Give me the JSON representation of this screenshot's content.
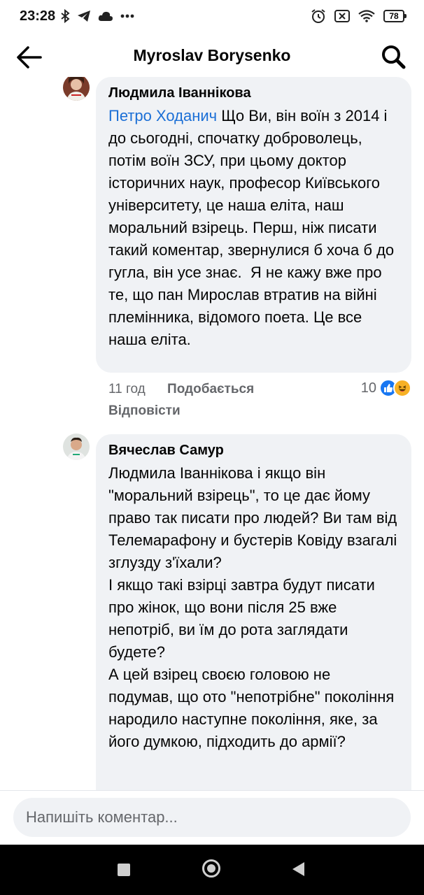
{
  "status_bar": {
    "time": "23:28",
    "battery": "78"
  },
  "header": {
    "title": "Myroslav Borysenko"
  },
  "comments": [
    {
      "author": "Людмила Іваннікова",
      "mention": "Петро Ходанич",
      "text": " Що Ви, він воїн з 2014 і до сьогодні, спочатку доброволець, потім воїн ЗСУ, при цьому доктор історичних наук, професор Київського університету, це наша еліта, наш моральний взірець. Перш, ніж писати такий коментар, звернулися б хоча б до гугла, він усе знає.  Я не кажу вже про те, що пан Мирослав втратив на війні племінника, відомого поета. Це все наша еліта.",
      "time": "11 год",
      "like_label": "Подобається",
      "reply_label": "Відповісти",
      "reaction_count": "10",
      "reactions": [
        "like-icon",
        "haha-icon"
      ]
    },
    {
      "author": "Вячеслав Самур",
      "text": "Людмила Іваннікова і якщо він \"моральний взірець\", то це дає йому право так писати про людей? Ви там від Телемарафону и бустерів Ковіду взагалі зглузду з'їхали?\nІ якщо такі взірці завтра будут писати про жінок, що вони після 25 вже непотріб, ви їм до рота заглядати будете?\nА цей взірец своєю головою не подумав, що ото \"непотрібне\" покоління народило наступне покоління, яке, за його думкою, підходить до армії?"
    }
  ],
  "composer": {
    "placeholder": "Напишіть коментар..."
  },
  "colors": {
    "bubble": "#f0f2f5",
    "mention": "#1b6fd6",
    "like": "#1877f2"
  }
}
